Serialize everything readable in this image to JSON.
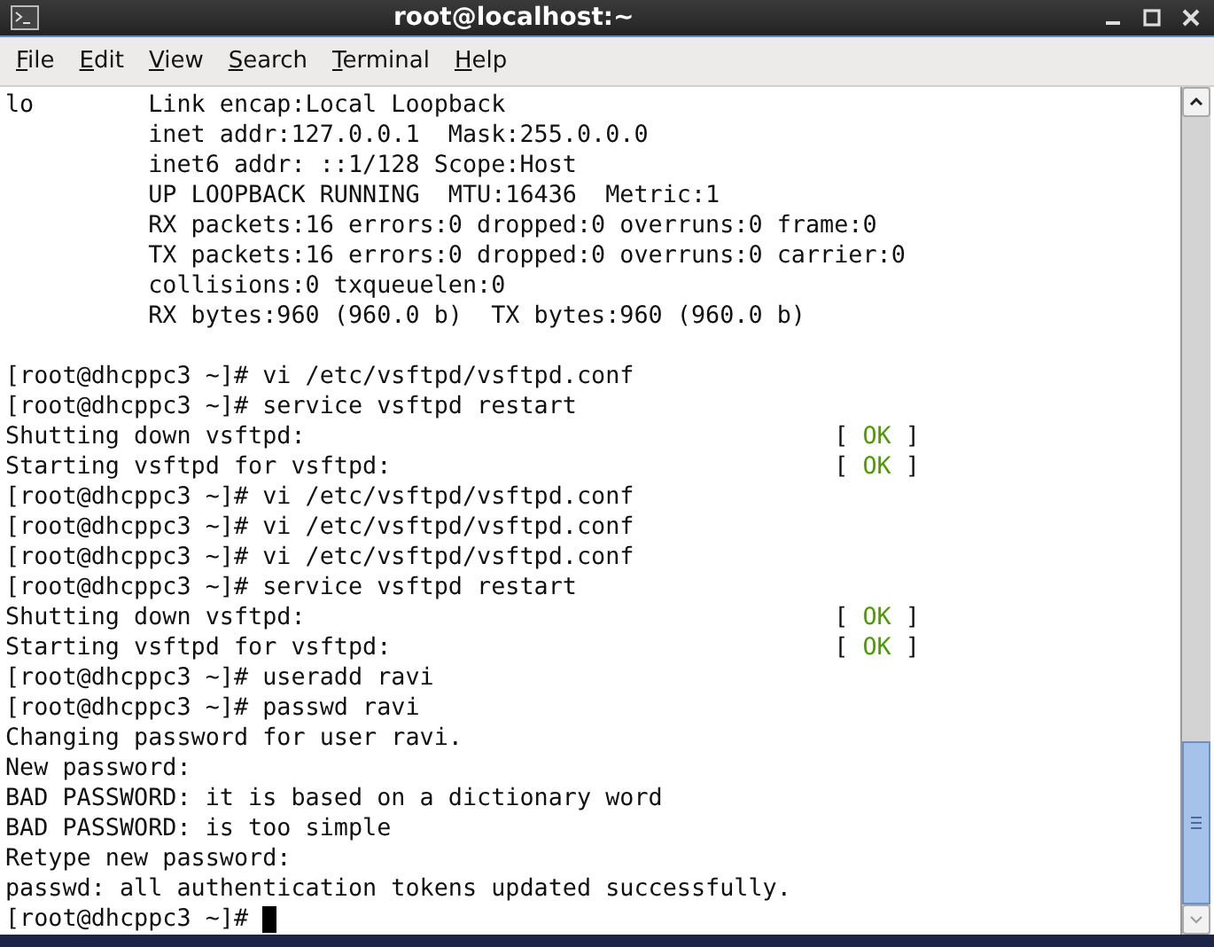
{
  "window": {
    "title": "root@localhost:~"
  },
  "menu": [
    "File",
    "Edit",
    "View",
    "Search",
    "Terminal",
    "Help"
  ],
  "lines": [
    {
      "kind": "text",
      "text": "lo        Link encap:Local Loopback"
    },
    {
      "kind": "text",
      "text": "          inet addr:127.0.0.1  Mask:255.0.0.0"
    },
    {
      "kind": "text",
      "text": "          inet6 addr: ::1/128 Scope:Host"
    },
    {
      "kind": "text",
      "text": "          UP LOOPBACK RUNNING  MTU:16436  Metric:1"
    },
    {
      "kind": "text",
      "text": "          RX packets:16 errors:0 dropped:0 overruns:0 frame:0"
    },
    {
      "kind": "text",
      "text": "          TX packets:16 errors:0 dropped:0 overruns:0 carrier:0"
    },
    {
      "kind": "text",
      "text": "          collisions:0 txqueuelen:0"
    },
    {
      "kind": "text",
      "text": "          RX bytes:960 (960.0 b)  TX bytes:960 (960.0 b)"
    },
    {
      "kind": "blank"
    },
    {
      "kind": "text",
      "text": "[root@dhcppc3 ~]# vi /etc/vsftpd/vsftpd.conf"
    },
    {
      "kind": "text",
      "text": "[root@dhcppc3 ~]# service vsftpd restart"
    },
    {
      "kind": "status",
      "text": "Shutting down vsftpd:",
      "status": {
        "open": "[",
        "label": "OK",
        "close": "]"
      }
    },
    {
      "kind": "status",
      "text": "Starting vsftpd for vsftpd:",
      "status": {
        "open": "[",
        "label": "OK",
        "close": "]"
      }
    },
    {
      "kind": "text",
      "text": "[root@dhcppc3 ~]# vi /etc/vsftpd/vsftpd.conf"
    },
    {
      "kind": "text",
      "text": "[root@dhcppc3 ~]# vi /etc/vsftpd/vsftpd.conf"
    },
    {
      "kind": "text",
      "text": "[root@dhcppc3 ~]# vi /etc/vsftpd/vsftpd.conf"
    },
    {
      "kind": "text",
      "text": "[root@dhcppc3 ~]# service vsftpd restart"
    },
    {
      "kind": "status",
      "text": "Shutting down vsftpd:",
      "status": {
        "open": "[",
        "label": "OK",
        "close": "]"
      }
    },
    {
      "kind": "status",
      "text": "Starting vsftpd for vsftpd:",
      "status": {
        "open": "[",
        "label": "OK",
        "close": "]"
      }
    },
    {
      "kind": "text",
      "text": "[root@dhcppc3 ~]# useradd ravi"
    },
    {
      "kind": "text",
      "text": "[root@dhcppc3 ~]# passwd ravi"
    },
    {
      "kind": "text",
      "text": "Changing password for user ravi."
    },
    {
      "kind": "text",
      "text": "New password:"
    },
    {
      "kind": "text",
      "text": "BAD PASSWORD: it is based on a dictionary word"
    },
    {
      "kind": "text",
      "text": "BAD PASSWORD: is too simple"
    },
    {
      "kind": "text",
      "text": "Retype new password:"
    },
    {
      "kind": "text",
      "text": "passwd: all authentication tokens updated successfully."
    },
    {
      "kind": "prompt",
      "text": "[root@dhcppc3 ~]#"
    }
  ]
}
